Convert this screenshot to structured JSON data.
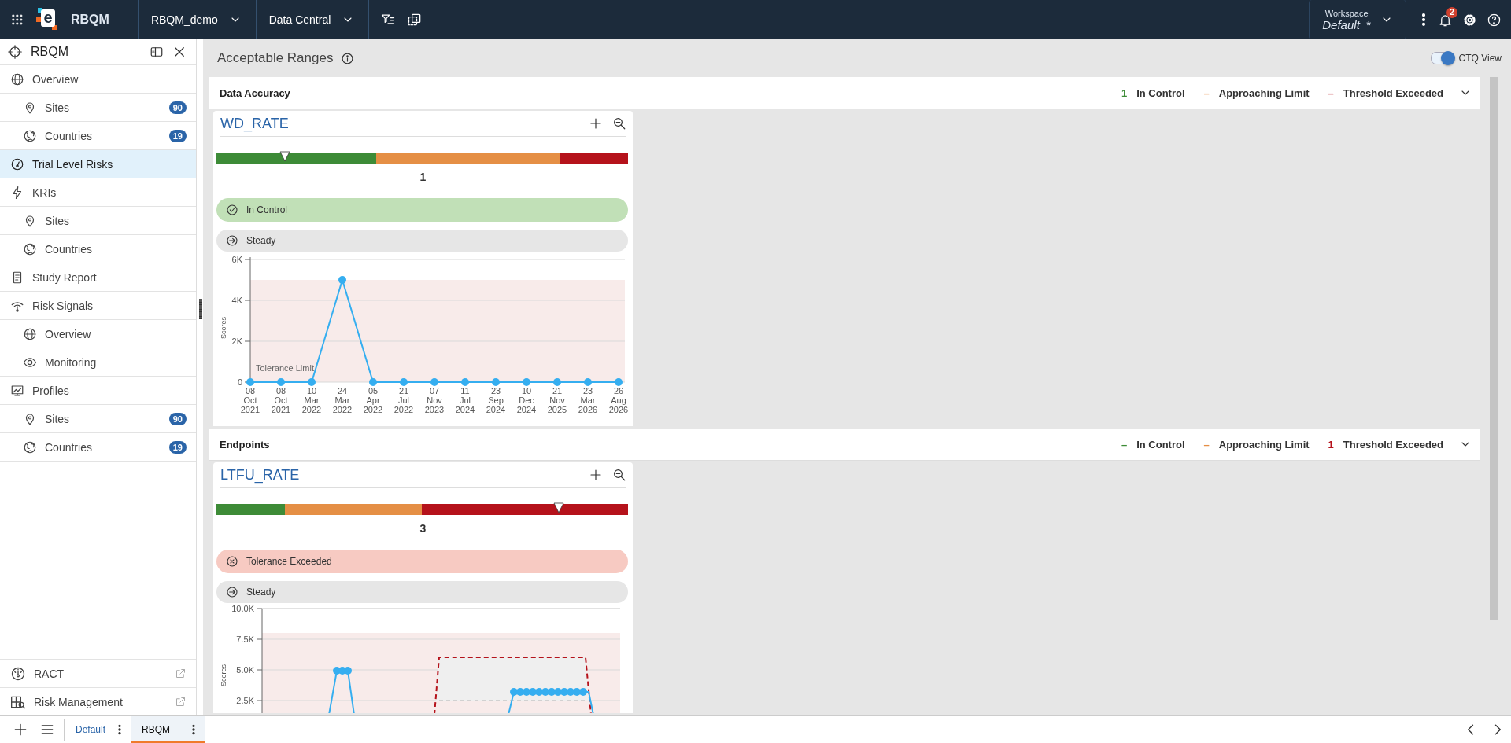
{
  "app": {
    "logo_letter": "e",
    "title": "RBQM"
  },
  "top_bar": {
    "study": "RBQM_demo",
    "module": "Data Central",
    "workspace_label": "Workspace",
    "workspace": "Default",
    "workspace_modified": "*",
    "notifications": "2"
  },
  "sidebar": {
    "title": "RBQM",
    "items": [
      {
        "label": "Overview",
        "selected": false,
        "children": [
          {
            "label": "Sites",
            "badge": "90",
            "selected": false
          },
          {
            "label": "Countries",
            "badge": "19",
            "selected": false
          }
        ]
      },
      {
        "label": "Trial Level Risks",
        "selected": true
      },
      {
        "label": "KRIs",
        "selected": false,
        "children": [
          {
            "label": "Sites",
            "selected": false
          },
          {
            "label": "Countries",
            "selected": false
          }
        ]
      },
      {
        "label": "Study Report",
        "selected": false
      },
      {
        "label": "Risk Signals",
        "selected": false,
        "children": [
          {
            "label": "Overview",
            "selected": false
          },
          {
            "label": "Monitoring",
            "selected": false
          }
        ]
      },
      {
        "label": "Profiles",
        "selected": false,
        "children": [
          {
            "label": "Sites",
            "badge": "90",
            "selected": false
          },
          {
            "label": "Countries",
            "badge": "19",
            "selected": false
          }
        ]
      }
    ],
    "links": [
      {
        "label": "RACT"
      },
      {
        "label": "Risk Management"
      }
    ]
  },
  "page": {
    "title": "Acceptable Ranges",
    "toggle": {
      "label": "CTQ View",
      "on": true
    }
  },
  "sections": [
    {
      "title": "Data Accuracy",
      "legend": [
        {
          "count": "1",
          "label": "In Control",
          "color": "#3d8b37"
        },
        {
          "count": "–",
          "label": "Approaching Limit",
          "color": "#e58f45"
        },
        {
          "count": "–",
          "label": "Threshold Exceeded",
          "color": "#b5121b"
        }
      ],
      "cards": [
        {
          "title": "WD_RATE",
          "gauge": {
            "segments": [
              {
                "color": "#3d8b37"
              },
              {
                "color": "#e58f45"
              },
              {
                "color": "#b5121b"
              }
            ],
            "value": "1"
          },
          "statuses": [
            {
              "kind": "in_control",
              "label": "In Control"
            },
            {
              "kind": "steady",
              "label": "Steady"
            }
          ],
          "chart_data": {
            "type": "line",
            "ylabel": "Scores",
            "categories": [
              "08 Oct 2021",
              "08 Oct 2021",
              "10 Mar 2022",
              "24 Mar 2022",
              "05 Apr 2022",
              "21 Jul 2022",
              "07 Nov 2023",
              "11 Jul 2024",
              "23 Sep 2024",
              "10 Dec 2024",
              "21 Nov 2025",
              "23 Mar 2026",
              "26 Aug 2026"
            ],
            "ylim": [
              0,
              6000
            ],
            "grid": true,
            "yticks": [
              {
                "value": 0,
                "label": "0"
              },
              {
                "value": 2000,
                "label": "2K"
              },
              {
                "value": 4000,
                "label": "4K"
              },
              {
                "value": 6000,
                "label": "6K"
              }
            ],
            "series": [
              {
                "color": "#35aef0",
                "marker": true,
                "values": [
                  0,
                  0,
                  0,
                  5000,
                  0,
                  0,
                  0,
                  0,
                  0,
                  0,
                  0,
                  0,
                  0
                ]
              }
            ],
            "bands": [
              {
                "axis": "y",
                "from": 0,
                "to": 5000
              }
            ],
            "annotations": [
              "Tolerance Limit"
            ]
          }
        }
      ]
    },
    {
      "title": "Endpoints",
      "legend": [
        {
          "count": "–",
          "label": "In Control",
          "color": "#3d8b37"
        },
        {
          "count": "–",
          "label": "Approaching Limit",
          "color": "#e58f45"
        },
        {
          "count": "1",
          "label": "Threshold Exceeded",
          "color": "#b5121b"
        }
      ],
      "cards": [
        {
          "title": "LTFU_RATE",
          "gauge": {
            "segments": [
              {
                "color": "#3d8b37"
              },
              {
                "color": "#e58f45"
              },
              {
                "color": "#b5121b"
              }
            ],
            "value": "3"
          },
          "statuses": [
            {
              "kind": "exceeded",
              "label": "Tolerance Exceeded"
            },
            {
              "kind": "steady",
              "label": "Steady"
            }
          ],
          "chart": {
            "ylabel": "Scores",
            "ytick_labels": [
              "10.0K",
              "7.5K",
              "5.0K",
              "2.5K"
            ]
          }
        }
      ]
    }
  ],
  "tabs": [
    {
      "label": "Default",
      "selected": false
    },
    {
      "label": "RBQM",
      "selected": true
    }
  ]
}
